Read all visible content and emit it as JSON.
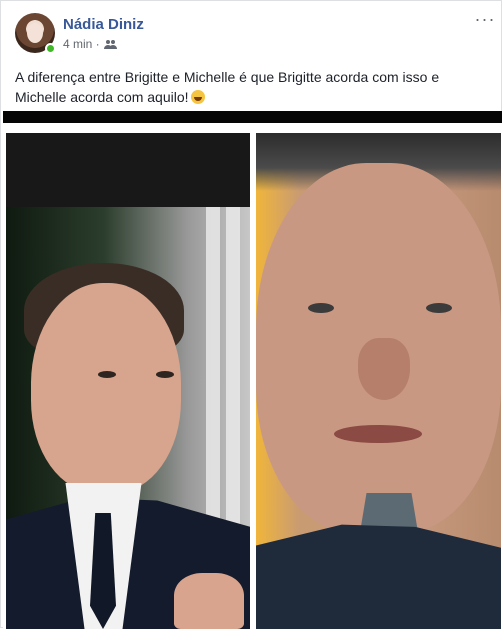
{
  "post": {
    "author_name": "Nádia Diniz",
    "time": "4 min ·",
    "text": "A diferença entre Brigitte e Michelle é que Brigitte acorda com isso e Michelle acorda com aquilo!"
  },
  "ui": {
    "more_label": "···"
  },
  "icons": {
    "audience": "friends-icon",
    "emoji": "laughing-emoji-icon"
  },
  "colors": {
    "author_link": "#385898",
    "meta_text": "#616770",
    "online": "#42b72a"
  }
}
